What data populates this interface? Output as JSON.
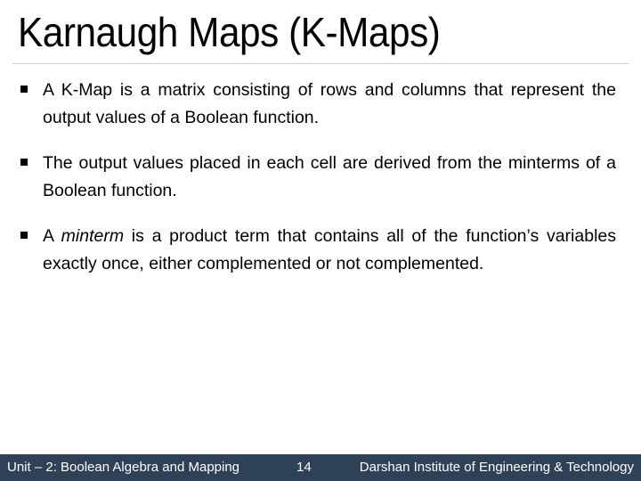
{
  "slide": {
    "title": "Karnaugh Maps (K-Maps)",
    "bullets": [
      {
        "text": "A K-Map is a matrix consisting of rows and columns that represent the output values of a Boolean function."
      },
      {
        "text": "The output values placed in each cell are derived from the minterms of a Boolean function."
      },
      {
        "prefix": "A ",
        "emphasis": "minterm",
        "suffix": " is a product term that contains all of the function’s variables exactly once, either complemented or not complemented."
      }
    ]
  },
  "footer": {
    "unit": "Unit – 2: Boolean Algebra and Mapping",
    "page_number": "14",
    "institute": "Darshan Institute of Engineering & Technology",
    "background_color": "#2e4156"
  }
}
